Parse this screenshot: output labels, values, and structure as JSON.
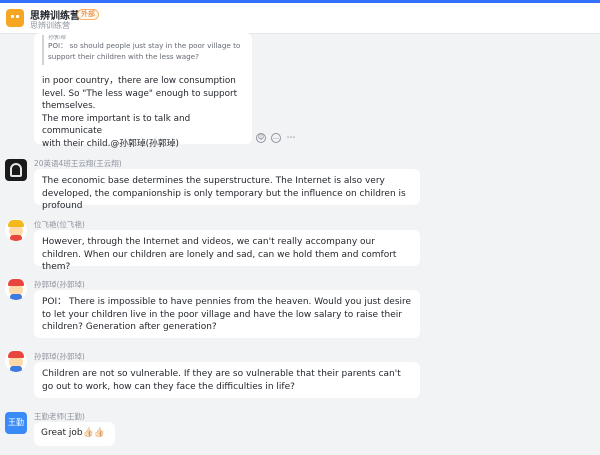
{
  "header": {
    "group_name": "思辨训练营",
    "tag": "外部",
    "subtitle": "思辨训练营"
  },
  "messages": [
    {
      "quote_name": "孙郭琸",
      "quote_text": "POI： so should people just stay in the poor village to support their children with the less wage?",
      "text_lines": [
        "in poor country，there are low consumption",
        "level. So  \"The less wage\"  enough to support",
        "themselves.",
        "The more important is to talk  and communicate",
        "with their child.@孙郭琸(孙郭琸)"
      ]
    },
    {
      "sender": "20英语4班王云翔(王云翔)",
      "avatar_icon": "headphones-avatar-icon",
      "text": "The economic base determines the superstructure. The Internet is also very developed, the companionship is only temporary but the influence on children is profound"
    },
    {
      "sender": "位飞艳(位飞艳)",
      "avatar_icon": "cartoon-avatar-icon",
      "text": "However, through the Internet and videos, we can't really accompany our children. When our children are lonely and sad, can we hold them and comfort them?"
    },
    {
      "sender": "孙郭琸(孙郭琸)",
      "avatar_icon": "cartoon-avatar-icon",
      "text": "POI： There is impossible to have pennies from the heaven. Would you just desire to let your children live in the poor village and have the low salary to raise their children? Generation after generation?"
    },
    {
      "sender": "孙郭琸(孙郭琸)",
      "avatar_icon": "cartoon-avatar-icon",
      "text": "Children are not so vulnerable. If they are so vulnerable that their parents can't go out to work, how can they face the difficulties in life?"
    },
    {
      "sender": "王勤老师(王勤)",
      "avatar_text": "王勤",
      "text": "Great job👍🏻👍🏻"
    }
  ],
  "actions": [
    "emoji-reaction-icon",
    "reply-icon",
    "more-icon"
  ],
  "colors": {
    "accent": "#3370ff",
    "background": "#f2f3f5",
    "bubble": "#ffffff",
    "app_icon": "#f6a623"
  }
}
